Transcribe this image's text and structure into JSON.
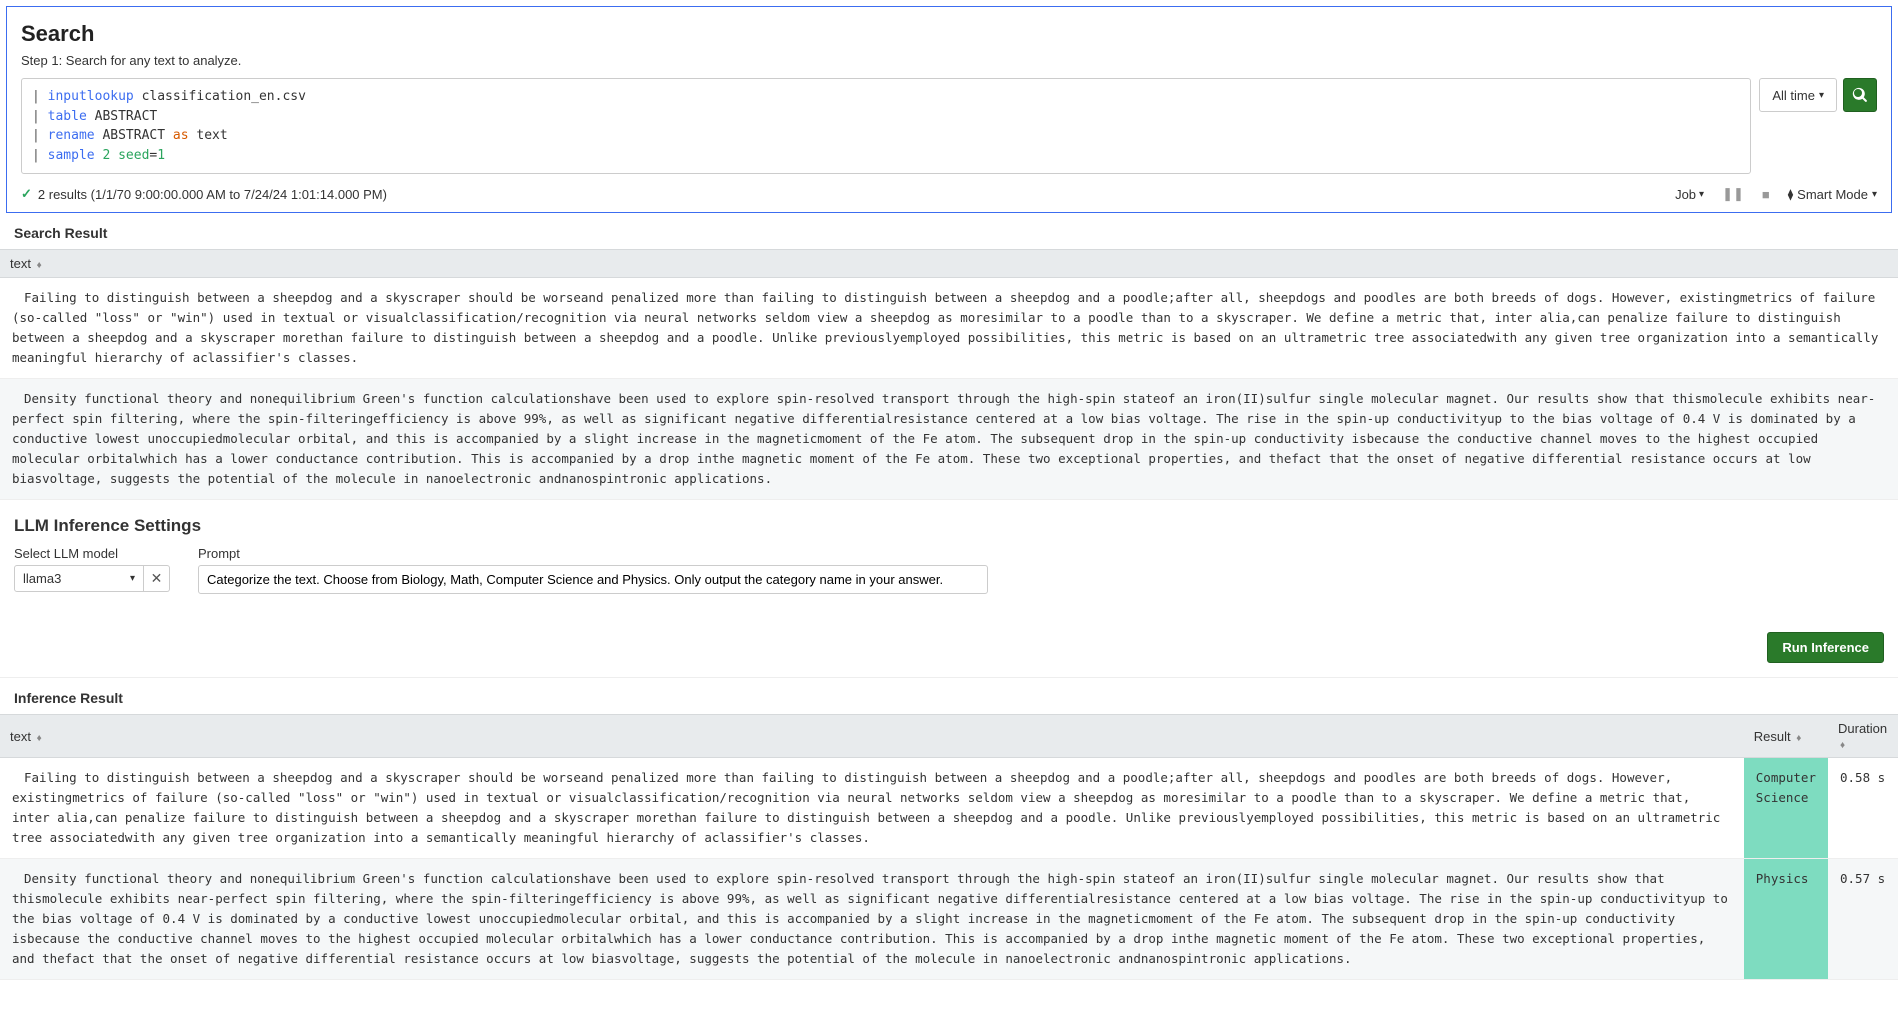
{
  "search": {
    "title": "Search",
    "subtitle": "Step 1: Search for any text to analyze.",
    "query_tokens": [
      {
        "t": "pipe",
        "v": "| "
      },
      {
        "t": "cmd",
        "v": "inputlookup"
      },
      {
        "t": "arg",
        "v": " classification_en.csv\n"
      },
      {
        "t": "pipe",
        "v": "| "
      },
      {
        "t": "cmd",
        "v": "table"
      },
      {
        "t": "arg",
        "v": " ABSTRACT\n"
      },
      {
        "t": "pipe",
        "v": "| "
      },
      {
        "t": "cmd",
        "v": "rename"
      },
      {
        "t": "arg",
        "v": " ABSTRACT "
      },
      {
        "t": "key",
        "v": "as"
      },
      {
        "t": "arg",
        "v": " text\n"
      },
      {
        "t": "pipe",
        "v": "| "
      },
      {
        "t": "cmd",
        "v": "sample"
      },
      {
        "t": "arg",
        "v": " "
      },
      {
        "t": "num",
        "v": "2"
      },
      {
        "t": "arg",
        "v": " "
      },
      {
        "t": "num",
        "v": "seed"
      },
      {
        "t": "arg",
        "v": "="
      },
      {
        "t": "num",
        "v": "1"
      }
    ],
    "time_label": "All time",
    "status": "2 results (1/1/70 9:00:00.000 AM to 7/24/24 1:01:14.000 PM)",
    "job_label": "Job",
    "mode_label": "Smart Mode"
  },
  "search_result": {
    "heading": "Search Result",
    "col_text": "text",
    "rows": [
      "Failing to distinguish between a sheepdog and a skyscraper should be worseand penalized more than failing to distinguish between a sheepdog and a poodle;after all, sheepdogs and poodles are both breeds of dogs. However, existingmetrics of failure (so-called \"loss\" or \"win\") used in textual or visualclassification/recognition via neural networks seldom view a sheepdog as moresimilar to a poodle than to a skyscraper. We define a metric that, inter alia,can penalize failure to distinguish between a sheepdog and a skyscraper morethan failure to distinguish between a sheepdog and a poodle. Unlike previouslyemployed possibilities, this metric is based on an ultrametric tree associatedwith any given tree organization into a semantically meaningful hierarchy of aclassifier's classes.",
      "Density functional theory and nonequilibrium Green's function calculationshave been used to explore spin-resolved transport through the high-spin stateof an iron(II)sulfur single molecular magnet. Our results show that thismolecule exhibits near-perfect spin filtering, where the spin-filteringefficiency is above 99%, as well as significant negative differentialresistance centered at a low bias voltage. The rise in the spin-up conductivityup to the bias voltage of 0.4 V is dominated by a conductive lowest unoccupiedmolecular orbital, and this is accompanied by a slight increase in the magneticmoment of the Fe atom. The subsequent drop in the spin-up conductivity isbecause the conductive channel moves to the highest occupied molecular orbitalwhich has a lower conductance contribution. This is accompanied by a drop inthe magnetic moment of the Fe atom. These two exceptional properties, and thefact that the onset of negative differential resistance occurs at low biasvoltage, suggests the potential of the molecule in nanoelectronic andnanospintronic applications."
    ]
  },
  "llm": {
    "heading": "LLM Inference Settings",
    "model_label": "Select LLM model",
    "model_value": "llama3",
    "prompt_label": "Prompt",
    "prompt_value": "Categorize the text. Choose from Biology, Math, Computer Science and Physics. Only output the category name in your answer.",
    "run_label": "Run Inference"
  },
  "inference": {
    "heading": "Inference Result",
    "col_text": "text",
    "col_result": "Result",
    "col_duration": "Duration",
    "rows": [
      {
        "text": "Failing to distinguish between a sheepdog and a skyscraper should be worseand penalized more than failing to distinguish between a sheepdog and a poodle;after all, sheepdogs and poodles are both breeds of dogs. However, existingmetrics of failure (so-called \"loss\" or \"win\") used in textual or visualclassification/recognition via neural networks seldom view a sheepdog as moresimilar to a poodle than to a skyscraper. We define a metric that, inter alia,can penalize failure to distinguish between a sheepdog and a skyscraper morethan failure to distinguish between a sheepdog and a poodle. Unlike previouslyemployed possibilities, this metric is based on an ultrametric tree associatedwith any given tree organization into a semantically meaningful hierarchy of aclassifier's classes.",
        "result": "Computer Science",
        "duration": "0.58 s"
      },
      {
        "text": "Density functional theory and nonequilibrium Green's function calculationshave been used to explore spin-resolved transport through the high-spin stateof an iron(II)sulfur single molecular magnet. Our results show that thismolecule exhibits near-perfect spin filtering, where the spin-filteringefficiency is above 99%, as well as significant negative differentialresistance centered at a low bias voltage. The rise in the spin-up conductivityup to the bias voltage of 0.4 V is dominated by a conductive lowest unoccupiedmolecular orbital, and this is accompanied by a slight increase in the magneticmoment of the Fe atom. The subsequent drop in the spin-up conductivity isbecause the conductive channel moves to the highest occupied molecular orbitalwhich has a lower conductance contribution. This is accompanied by a drop inthe magnetic moment of the Fe atom. These two exceptional properties, and thefact that the onset of negative differential resistance occurs at low biasvoltage, suggests the potential of the molecule in nanoelectronic andnanospintronic applications.",
        "result": "Physics",
        "duration": "0.57 s"
      }
    ]
  }
}
